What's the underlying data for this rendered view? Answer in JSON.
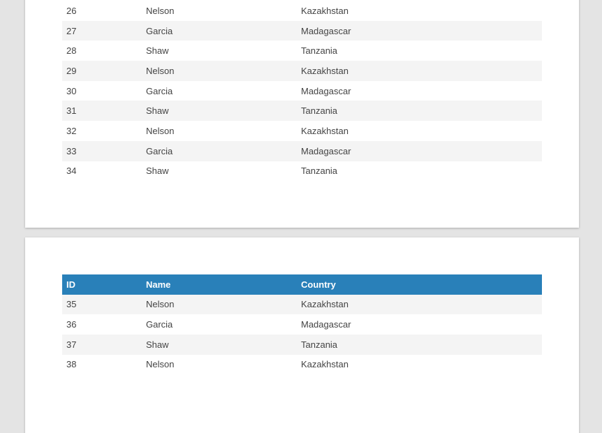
{
  "table_header": {
    "id": "ID",
    "name": "Name",
    "country": "Country"
  },
  "page1": {
    "rows": [
      {
        "id": "26",
        "name": "Nelson",
        "country": "Kazakhstan"
      },
      {
        "id": "27",
        "name": "Garcia",
        "country": "Madagascar"
      },
      {
        "id": "28",
        "name": "Shaw",
        "country": "Tanzania"
      },
      {
        "id": "29",
        "name": "Nelson",
        "country": "Kazakhstan"
      },
      {
        "id": "30",
        "name": "Garcia",
        "country": "Madagascar"
      },
      {
        "id": "31",
        "name": "Shaw",
        "country": "Tanzania"
      },
      {
        "id": "32",
        "name": "Nelson",
        "country": "Kazakhstan"
      },
      {
        "id": "33",
        "name": "Garcia",
        "country": "Madagascar"
      },
      {
        "id": "34",
        "name": "Shaw",
        "country": "Tanzania"
      }
    ]
  },
  "page2": {
    "rows": [
      {
        "id": "35",
        "name": "Nelson",
        "country": "Kazakhstan"
      },
      {
        "id": "36",
        "name": "Garcia",
        "country": "Madagascar"
      },
      {
        "id": "37",
        "name": "Shaw",
        "country": "Tanzania"
      },
      {
        "id": "38",
        "name": "Nelson",
        "country": "Kazakhstan"
      }
    ]
  },
  "colors": {
    "header_bg": "#2980b9",
    "row_shade": "#f4f4f4",
    "page_bg": "#ffffff",
    "viewer_bg": "#e4e4e4"
  }
}
